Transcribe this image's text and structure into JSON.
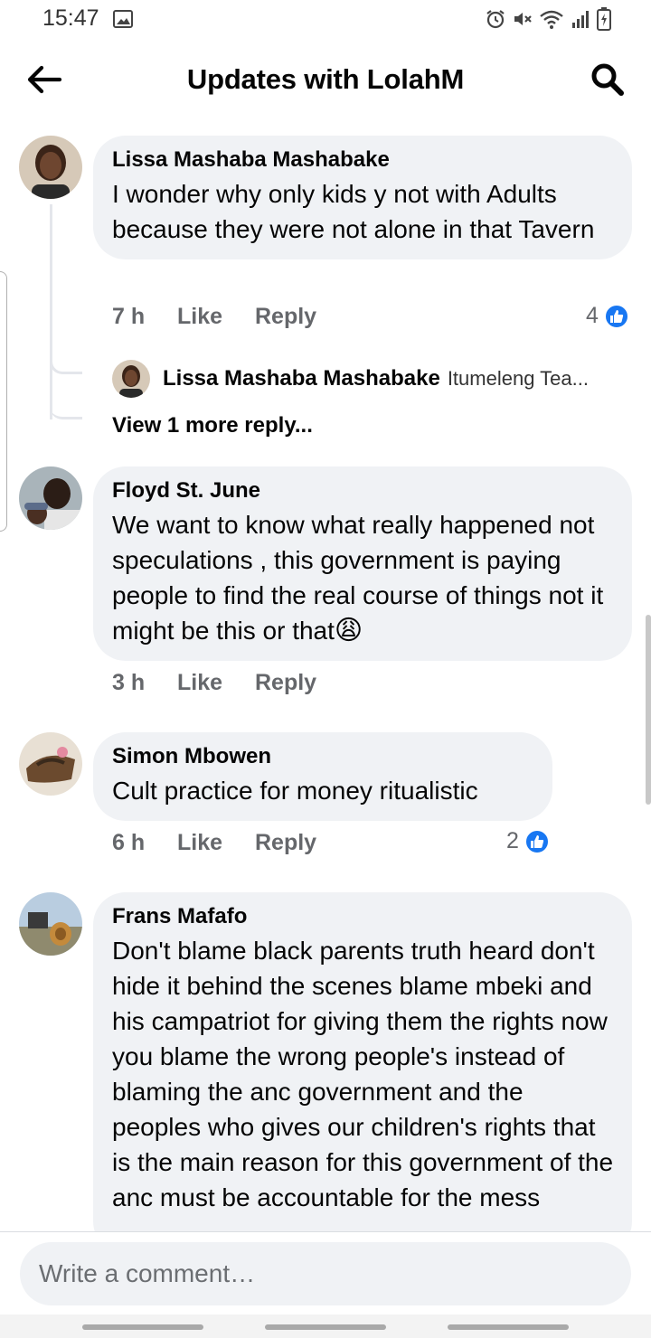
{
  "status_bar": {
    "time": "15:47",
    "left_icons": [
      "image-icon"
    ],
    "right_icons": [
      "alarm-icon",
      "mute-icon",
      "wifi-icon",
      "signal-icon",
      "battery-charging-icon"
    ]
  },
  "header": {
    "title": "Updates with LolahM",
    "back_icon": "arrow-left-icon",
    "search_icon": "search-icon"
  },
  "comments": [
    {
      "author": "Lissa Mashaba Mashabake",
      "text": "I wonder why only kids y not with Adults because they were not alone in that Tavern",
      "time": "7 h",
      "like_label": "Like",
      "reply_label": "Reply",
      "reactions": "4",
      "reply_preview": {
        "author": "Lissa Mashaba Mashabake",
        "text": "Itumeleng Tea..."
      },
      "view_more": "View 1 more reply..."
    },
    {
      "author": "Floyd St. June",
      "text": "We want to know what really happened not speculations , this government is paying people to find the real course of things not it might be this or that",
      "emoji": "😩",
      "time": "3 h",
      "like_label": "Like",
      "reply_label": "Reply"
    },
    {
      "author": "Simon Mbowen",
      "text": "Cult practice for money ritualistic",
      "time": "6 h",
      "like_label": "Like",
      "reply_label": "Reply",
      "reactions": "2"
    },
    {
      "author": "Frans Mafafo",
      "text": "Don't blame black parents truth heard don't hide it behind the scenes blame mbeki and his campatriot for giving them the rights now you blame the wrong people's instead of blaming the anc government and the peoples who gives our children's rights that is the main reason for this government of the anc must be accountable for the mess"
    }
  ],
  "composer": {
    "placeholder": "Write a comment…"
  },
  "colors": {
    "bubble": "#f0f2f5",
    "muted_text": "#65676b",
    "like_blue": "#1877f2"
  }
}
